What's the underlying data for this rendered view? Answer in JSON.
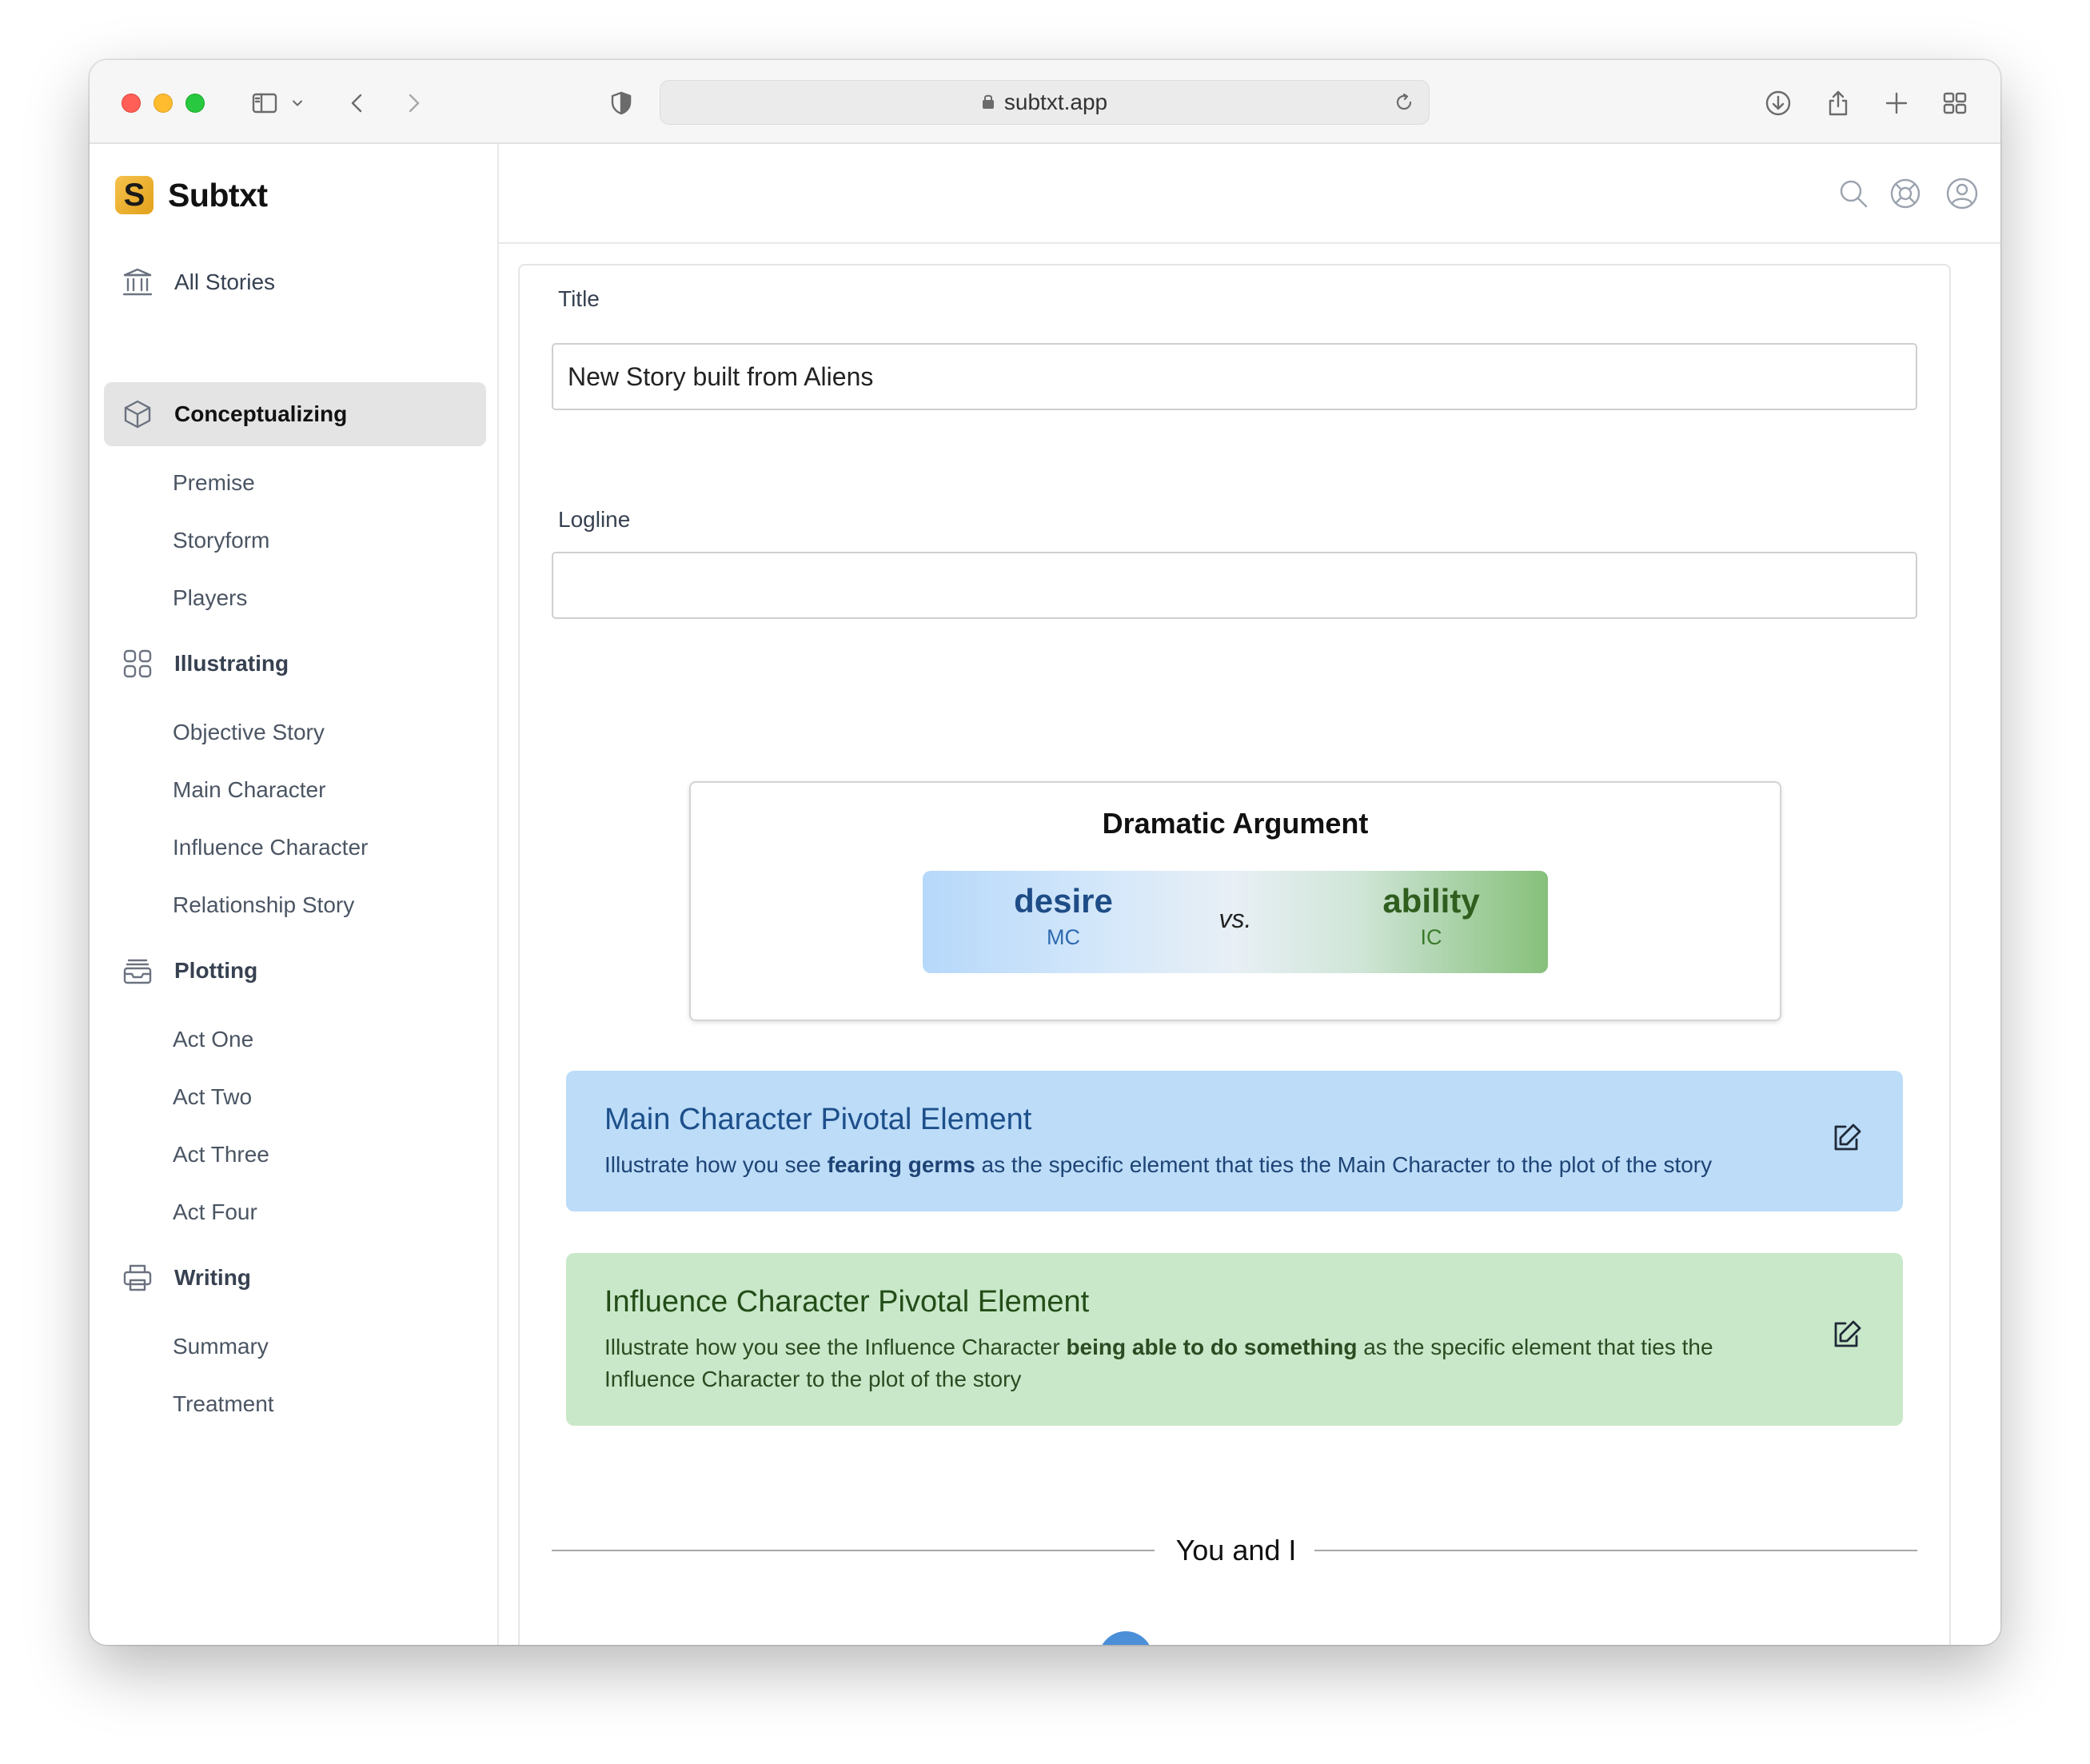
{
  "browser": {
    "url": "subtxt.app"
  },
  "sidebar": {
    "brand_initial": "S",
    "brand_name": "Subtxt",
    "all_stories": "All Stories",
    "sections": [
      {
        "label": "Conceptualizing",
        "icon": "cube-icon",
        "items": [
          "Premise",
          "Storyform",
          "Players"
        ]
      },
      {
        "label": "Illustrating",
        "icon": "grid-icon",
        "items": [
          "Objective Story",
          "Main Character",
          "Influence Character",
          "Relationship Story"
        ]
      },
      {
        "label": "Plotting",
        "icon": "inbox-stack-icon",
        "items": [
          "Act One",
          "Act Two",
          "Act Three",
          "Act Four"
        ]
      },
      {
        "label": "Writing",
        "icon": "printer-icon",
        "items": [
          "Summary",
          "Treatment"
        ]
      }
    ]
  },
  "form": {
    "title_label": "Title",
    "title_value": "New Story built from Aliens",
    "logline_label": "Logline",
    "logline_value": ""
  },
  "dramatic_argument": {
    "heading": "Dramatic Argument",
    "left_word": "desire",
    "left_tag": "MC",
    "vs": "vs.",
    "right_word": "ability",
    "right_tag": "IC",
    "colors": {
      "mc": "#bcdcf8",
      "ic": "#c9e8c9",
      "ic_bar_end": "#86c07a"
    }
  },
  "pivots": {
    "mc": {
      "title": "Main Character Pivotal Element",
      "text_pre": "Illustrate how you see ",
      "text_bold": "fearing germs",
      "text_post": " as the specific element that ties the Main Character to the plot of the story"
    },
    "ic": {
      "title": "Influence Character Pivotal Element",
      "text_pre": "Illustrate how you see the Influence Character ",
      "text_bold": "being able to do something",
      "text_post": " as the specific element that ties the Influence Character to the plot of the story"
    }
  },
  "section_divider": "You and I"
}
